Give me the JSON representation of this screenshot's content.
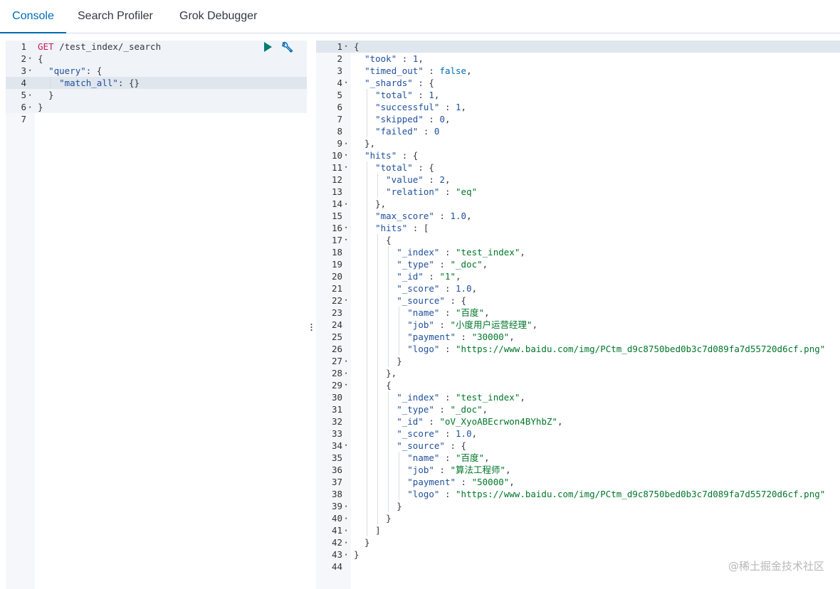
{
  "tabs": [
    {
      "label": "Console",
      "active": true
    },
    {
      "label": "Search Profiler",
      "active": false
    },
    {
      "label": "Grok Debugger",
      "active": false
    }
  ],
  "request": {
    "lines": [
      {
        "n": "1",
        "text": "GET /test_index/_search",
        "fold": ""
      },
      {
        "n": "2",
        "text": "{",
        "fold": "▾"
      },
      {
        "n": "3",
        "text": "  \"query\": {",
        "fold": "▾"
      },
      {
        "n": "4",
        "text": "    \"match_all\": {}",
        "fold": ""
      },
      {
        "n": "5",
        "text": "  }",
        "fold": "▴"
      },
      {
        "n": "6",
        "text": "}",
        "fold": "▴"
      },
      {
        "n": "7",
        "text": "",
        "fold": ""
      }
    ],
    "run_icon": "play-icon",
    "settings_icon": "wrench-icon"
  },
  "response": {
    "lines": [
      {
        "n": "1",
        "text": "{",
        "fold": "▾"
      },
      {
        "n": "2",
        "text": "  \"took\" : 1,",
        "fold": ""
      },
      {
        "n": "3",
        "text": "  \"timed_out\" : false,",
        "fold": ""
      },
      {
        "n": "4",
        "text": "  \"_shards\" : {",
        "fold": "▾"
      },
      {
        "n": "5",
        "text": "    \"total\" : 1,",
        "fold": ""
      },
      {
        "n": "6",
        "text": "    \"successful\" : 1,",
        "fold": ""
      },
      {
        "n": "7",
        "text": "    \"skipped\" : 0,",
        "fold": ""
      },
      {
        "n": "8",
        "text": "    \"failed\" : 0",
        "fold": ""
      },
      {
        "n": "9",
        "text": "  },",
        "fold": "▴"
      },
      {
        "n": "10",
        "text": "  \"hits\" : {",
        "fold": "▾"
      },
      {
        "n": "11",
        "text": "    \"total\" : {",
        "fold": "▾"
      },
      {
        "n": "12",
        "text": "      \"value\" : 2,",
        "fold": ""
      },
      {
        "n": "13",
        "text": "      \"relation\" : \"eq\"",
        "fold": ""
      },
      {
        "n": "14",
        "text": "    },",
        "fold": "▴"
      },
      {
        "n": "15",
        "text": "    \"max_score\" : 1.0,",
        "fold": ""
      },
      {
        "n": "16",
        "text": "    \"hits\" : [",
        "fold": "▾"
      },
      {
        "n": "17",
        "text": "      {",
        "fold": "▾"
      },
      {
        "n": "18",
        "text": "        \"_index\" : \"test_index\",",
        "fold": ""
      },
      {
        "n": "19",
        "text": "        \"_type\" : \"_doc\",",
        "fold": ""
      },
      {
        "n": "20",
        "text": "        \"_id\" : \"1\",",
        "fold": ""
      },
      {
        "n": "21",
        "text": "        \"_score\" : 1.0,",
        "fold": ""
      },
      {
        "n": "22",
        "text": "        \"_source\" : {",
        "fold": "▾"
      },
      {
        "n": "23",
        "text": "          \"name\" : \"百度\",",
        "fold": ""
      },
      {
        "n": "24",
        "text": "          \"job\" : \"小度用户运营经理\",",
        "fold": ""
      },
      {
        "n": "25",
        "text": "          \"payment\" : \"30000\",",
        "fold": ""
      },
      {
        "n": "26",
        "text": "          \"logo\" : \"https://www.baidu.com/img/PCtm_d9c8750bed0b3c7d089fa7d55720d6cf.png\"",
        "fold": ""
      },
      {
        "n": "27",
        "text": "        }",
        "fold": "▴"
      },
      {
        "n": "28",
        "text": "      },",
        "fold": "▴"
      },
      {
        "n": "29",
        "text": "      {",
        "fold": "▾"
      },
      {
        "n": "30",
        "text": "        \"_index\" : \"test_index\",",
        "fold": ""
      },
      {
        "n": "31",
        "text": "        \"_type\" : \"_doc\",",
        "fold": ""
      },
      {
        "n": "32",
        "text": "        \"_id\" : \"oV_XyoABEcrwon4BYhbZ\",",
        "fold": ""
      },
      {
        "n": "33",
        "text": "        \"_score\" : 1.0,",
        "fold": ""
      },
      {
        "n": "34",
        "text": "        \"_source\" : {",
        "fold": "▾"
      },
      {
        "n": "35",
        "text": "          \"name\" : \"百度\",",
        "fold": ""
      },
      {
        "n": "36",
        "text": "          \"job\" : \"算法工程师\",",
        "fold": ""
      },
      {
        "n": "37",
        "text": "          \"payment\" : \"50000\",",
        "fold": ""
      },
      {
        "n": "38",
        "text": "          \"logo\" : \"https://www.baidu.com/img/PCtm_d9c8750bed0b3c7d089fa7d55720d6cf.png\"",
        "fold": ""
      },
      {
        "n": "39",
        "text": "        }",
        "fold": "▴"
      },
      {
        "n": "40",
        "text": "      }",
        "fold": "▴"
      },
      {
        "n": "41",
        "text": "    ]",
        "fold": "▴"
      },
      {
        "n": "42",
        "text": "  }",
        "fold": "▴"
      },
      {
        "n": "43",
        "text": "}",
        "fold": "▴"
      },
      {
        "n": "44",
        "text": "",
        "fold": ""
      }
    ]
  },
  "watermark": "@稀土掘金技术社区",
  "colors": {
    "accent": "#006bb4",
    "string": "#00762a",
    "key": "#1f4f9c",
    "method": "#c61a59",
    "active_line": "#e0e6ee",
    "gutter": "#f5f7fa"
  }
}
